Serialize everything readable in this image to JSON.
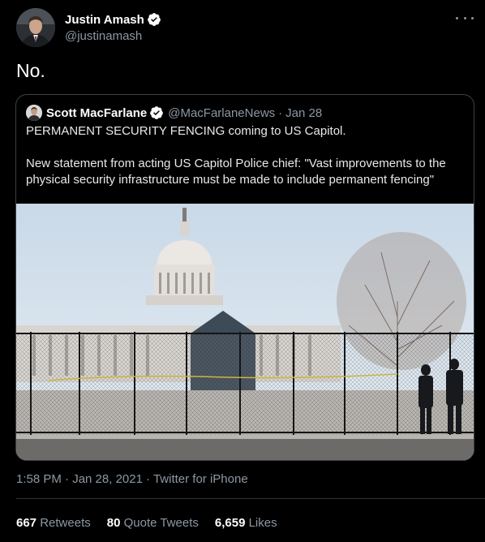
{
  "tweet": {
    "author": {
      "name": "Justin Amash",
      "handle": "@justinamash"
    },
    "text": "No.",
    "timestamp": "1:58 PM · Jan 28, 2021",
    "separator": "·",
    "source": "Twitter for iPhone"
  },
  "quoted": {
    "name": "Scott MacFarlane",
    "handle": "@MacFarlaneNews",
    "separator": "·",
    "date": "Jan 28",
    "text_line1": "PERMANENT SECURITY FENCING coming to US Capitol.",
    "text_line2": "New statement from acting US Capitol Police chief: \"Vast improvements to the physical security infrastructure must be made to include permanent fencing\""
  },
  "stats": {
    "retweets_count": "667",
    "retweets_label": "Retweets",
    "quotes_count": "80",
    "quotes_label": "Quote Tweets",
    "likes_count": "6,659",
    "likes_label": "Likes"
  },
  "colors": {
    "background": "#000000",
    "verified": "#ffffff",
    "muted": "#8b98a5",
    "border": "#2f3336"
  },
  "icons": {
    "verified": "verified-badge-icon",
    "more": "more-options-icon"
  }
}
